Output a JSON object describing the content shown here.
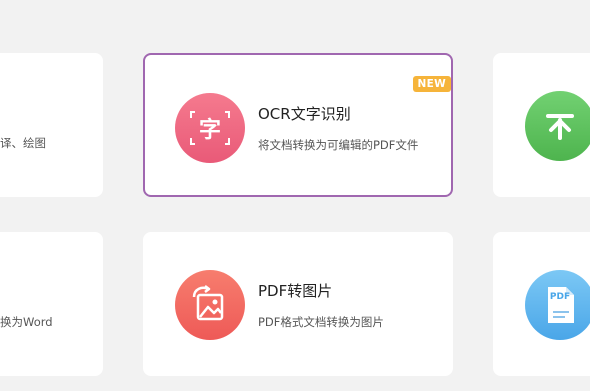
{
  "cards": {
    "top_left": {
      "desc_fragment": "译、绘图"
    },
    "ocr": {
      "title": "OCR文字识别",
      "desc": "将文档转换为可编辑的PDF文件",
      "badge": "NEW",
      "icon_glyph": "字",
      "icon": "ocr-character-icon",
      "icon_color": "#f06b82"
    },
    "top_right": {
      "icon": "upload-arrow-icon",
      "icon_color": "#5cc25c"
    },
    "bottom_left": {
      "desc_fragment": "换为Word"
    },
    "pdf_to_image": {
      "title": "PDF转图片",
      "desc": "PDF格式文档转换为图片",
      "icon": "pdf-to-image-icon",
      "icon_color": "#f56a5f"
    },
    "bottom_right": {
      "icon": "pdf-document-icon",
      "icon_color": "#5ab3ef",
      "icon_text": "PDF"
    }
  },
  "colors": {
    "background": "#f2f2f2",
    "selected_border": "#a067b0",
    "badge": "#f6b43a"
  }
}
